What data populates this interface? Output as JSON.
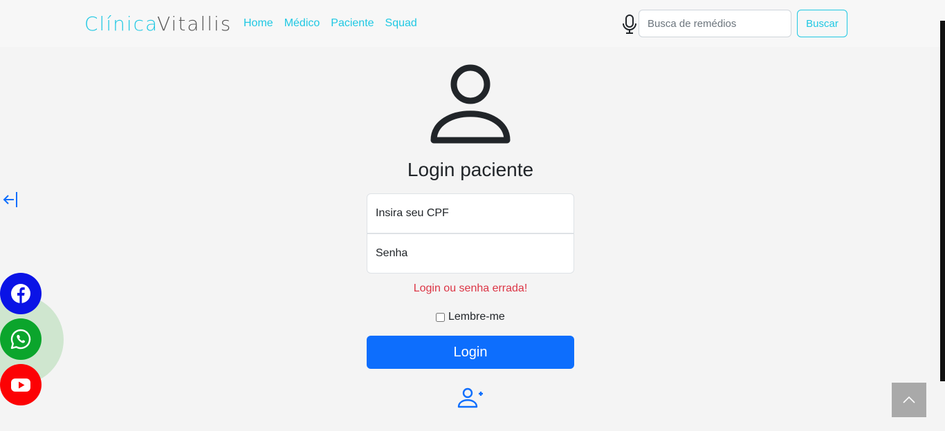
{
  "brand": {
    "part1": "Clínica",
    "part2": "Vitallis"
  },
  "nav": {
    "links": [
      "Home",
      "Médico",
      "Paciente",
      "Squad"
    ]
  },
  "search": {
    "placeholder": "Busca de remédios",
    "button": "Buscar"
  },
  "login": {
    "title": "Login paciente",
    "cpf_placeholder": "Insira seu CPF",
    "password_placeholder": "Senha",
    "error": "Login ou senha errada!",
    "remember_label": "Lembre-me",
    "button": "Login"
  },
  "colors": {
    "brand_accent": "#1fc8e3",
    "primary": "#0d6efd",
    "error": "#dc3545",
    "facebook": "#0a13e6",
    "whatsapp": "#0ba52c",
    "youtube": "#fc0204"
  },
  "icons": [
    "microphone-icon",
    "back-arrow-icon",
    "user-icon",
    "add-user-icon",
    "facebook-icon",
    "whatsapp-icon",
    "youtube-icon",
    "chevron-up-icon"
  ]
}
